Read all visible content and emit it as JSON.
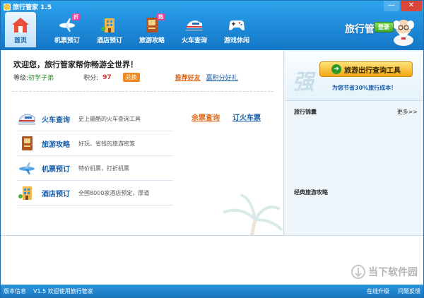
{
  "window": {
    "title": "旅行管家 1.5",
    "minimize": "—",
    "close": "✕"
  },
  "nav": [
    {
      "label": "首页",
      "icon": "home-icon"
    },
    {
      "label": "机票预订",
      "icon": "airplane-icon",
      "badge": "折"
    },
    {
      "label": "酒店预订",
      "icon": "hotel-icon"
    },
    {
      "label": "旅游攻略",
      "icon": "guidebook-icon",
      "badge": "热"
    },
    {
      "label": "火车查询",
      "icon": "train-icon"
    },
    {
      "label": "游戏休闲",
      "icon": "gamepad-icon"
    }
  ],
  "brand": {
    "text": "旅行管",
    "house": "家",
    "login": "登录"
  },
  "welcome": "欢迎您，旅行管家帮你畅游全世界！",
  "user": {
    "level_label": "等级:",
    "level_value": "初学子弟",
    "points_label": "积分:",
    "points_value": "97",
    "exchange": "兑换",
    "recommend": "推荐好友",
    "gift": "赢积分好礼"
  },
  "services": [
    {
      "name": "火车查询",
      "desc": "史上最酷的火车查询工具",
      "icon": "train-icon"
    },
    {
      "name": "旅游攻略",
      "desc": "好玩，省钱的旅游密笈",
      "icon": "guidebook-icon"
    },
    {
      "name": "机票预订",
      "desc": "特价机票，打折机票",
      "icon": "airplane-icon"
    },
    {
      "name": "酒店预订",
      "desc": "全国8000家酒店预定，厚道",
      "icon": "hotel-icon"
    }
  ],
  "train_links": {
    "remaining": "余票查询",
    "book": "订火车票"
  },
  "right_panel": {
    "tool_button": "旅游出行查询工具",
    "tool_sub": "为您节省30%旅行成本！",
    "watermark_char": "强",
    "tips_title": "旅行锦囊",
    "more": "更多>>",
    "guide_title": "经典旅游攻略"
  },
  "footer_logo": "当下软件园",
  "status": {
    "version_info": "版本信息",
    "welcome": "V1.5 欢迎使用旅行管家",
    "upgrade": "在线升级",
    "feedback": "问题反馈"
  },
  "colors": {
    "header": "#1e8ad8",
    "accent_orange": "#e2691a",
    "link_blue": "#1a5fa8",
    "button_gold": "#f3a612"
  }
}
